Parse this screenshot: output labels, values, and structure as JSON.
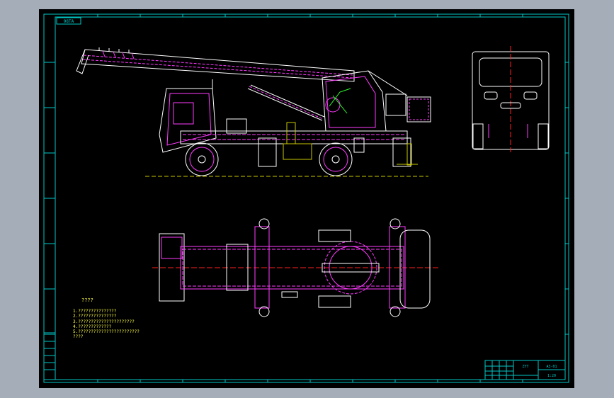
{
  "app": {
    "background": "#a5aeb8",
    "sheet": "#000000"
  },
  "colors": {
    "frame": "#00c8c8",
    "truck": "#ff3cff",
    "boom": "#ffffff",
    "centerline": "#ff2020",
    "ground": "#c8c800",
    "accent_green": "#30ff30",
    "notes": "#ffff40"
  },
  "drawing": {
    "title_tag": "98TA",
    "notes_heading": "????",
    "notes": [
      "1.???????????????",
      "2.???????????????",
      "3.??????????????????????",
      "4.?????????????",
      "5.????????????????????????",
      "  ????"
    ],
    "title_block": {
      "name_cell": "ZYT",
      "code_cell": "A3-01",
      "scale_cell": "1:20"
    }
  }
}
